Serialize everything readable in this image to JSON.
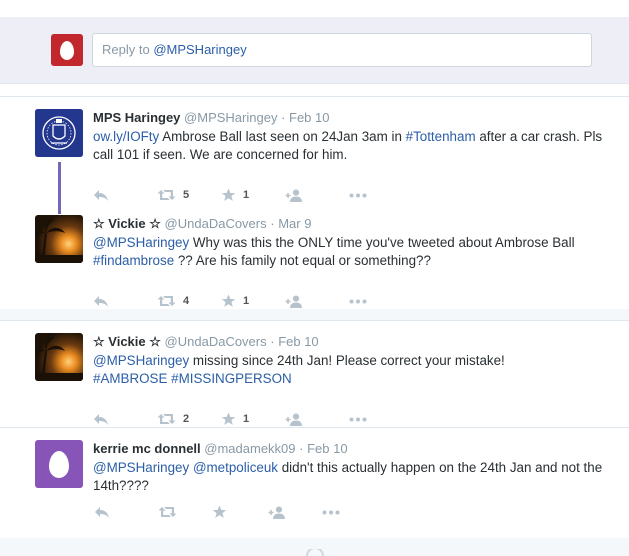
{
  "reply_box": {
    "placeholder_prefix": "Reply to ",
    "handle": "@MPSHaringey"
  },
  "tweets": [
    {
      "name": "MPS Haringey",
      "handle": "@MPSHaringey",
      "date": "Feb 10",
      "link": "ow.ly/IOFty",
      "text_a": " Ambrose Ball last seen on 24Jan 3am in ",
      "hashtag": "#Tottenham",
      "text_b": " after a car crash. Pls call 101 if seen. We are concerned for him.",
      "retweets": "5",
      "favorites": "1"
    },
    {
      "star": "☆",
      "name": "Vickie",
      "handle": "@UndaDaCovers",
      "date": "Mar 9",
      "mention": "@MPSHaringey",
      "text_a": " Why was this the ONLY time you've tweeted about Ambrose Ball ",
      "hashtag": "#findambrose",
      "text_b": " ?? Are his family not equal or something??",
      "retweets": "4",
      "favorites": "1"
    },
    {
      "star": "☆",
      "name": "Vickie",
      "handle": "@UndaDaCovers",
      "date": "Feb 10",
      "mention": "@MPSHaringey",
      "text_a": " missing since 24th Jan! Please correct your mistake!",
      "hashtag1": "#AMBROSE",
      "hashtag2": "#MISSINGPERSON",
      "retweets": "2",
      "favorites": "1"
    },
    {
      "name": "kerrie mc donnell",
      "handle": "@madamekk09",
      "date": "Feb 10",
      "mention1": "@MPSHaringey",
      "mention2": "@metpoliceuk",
      "text_a": "  didn't this actually happen on the 24th Jan and not the 14th????",
      "retweets": "",
      "favorites": ""
    }
  ],
  "separator": " · ",
  "colors": {
    "link": "#2b5ea8",
    "egg_red": "#c1272d",
    "egg_purple": "#8755b7",
    "thread_line": "#7866b8"
  }
}
